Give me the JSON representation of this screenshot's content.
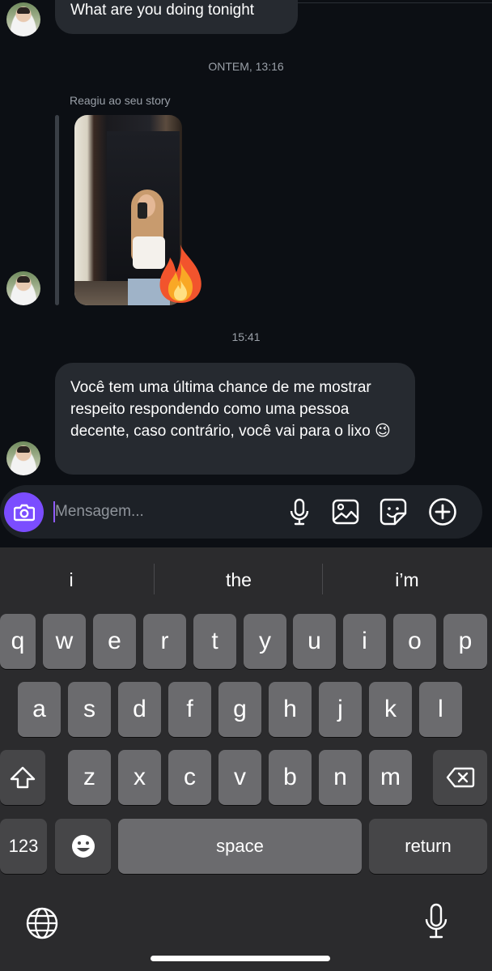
{
  "messages": {
    "top_partial": "What are you doing tonight",
    "date_separator": "ONTEM, 13:16",
    "story_reply_label": "Reagiu ao seu story",
    "story_reaction_icon": "fire-emoji",
    "time_separator": "15:41",
    "last_message": "Você tem uma última chance de me mostrar respeito respondendo como uma pessoa decente, caso contrário, você vai para o lixo 😉"
  },
  "composer": {
    "placeholder": "Mensagem...",
    "icons": [
      "camera-icon",
      "microphone-icon",
      "gallery-icon",
      "sticker-icon",
      "add-icon"
    ],
    "accent_color": "#7b4dff"
  },
  "keyboard": {
    "suggestions": [
      "i",
      "the",
      "i’m"
    ],
    "row1": [
      "q",
      "w",
      "e",
      "r",
      "t",
      "y",
      "u",
      "i",
      "o",
      "p"
    ],
    "row2": [
      "a",
      "s",
      "d",
      "f",
      "g",
      "h",
      "j",
      "k",
      "l"
    ],
    "row3": [
      "z",
      "x",
      "c",
      "v",
      "b",
      "n",
      "m"
    ],
    "numbers_label": "123",
    "space_label": "space",
    "return_label": "return"
  }
}
